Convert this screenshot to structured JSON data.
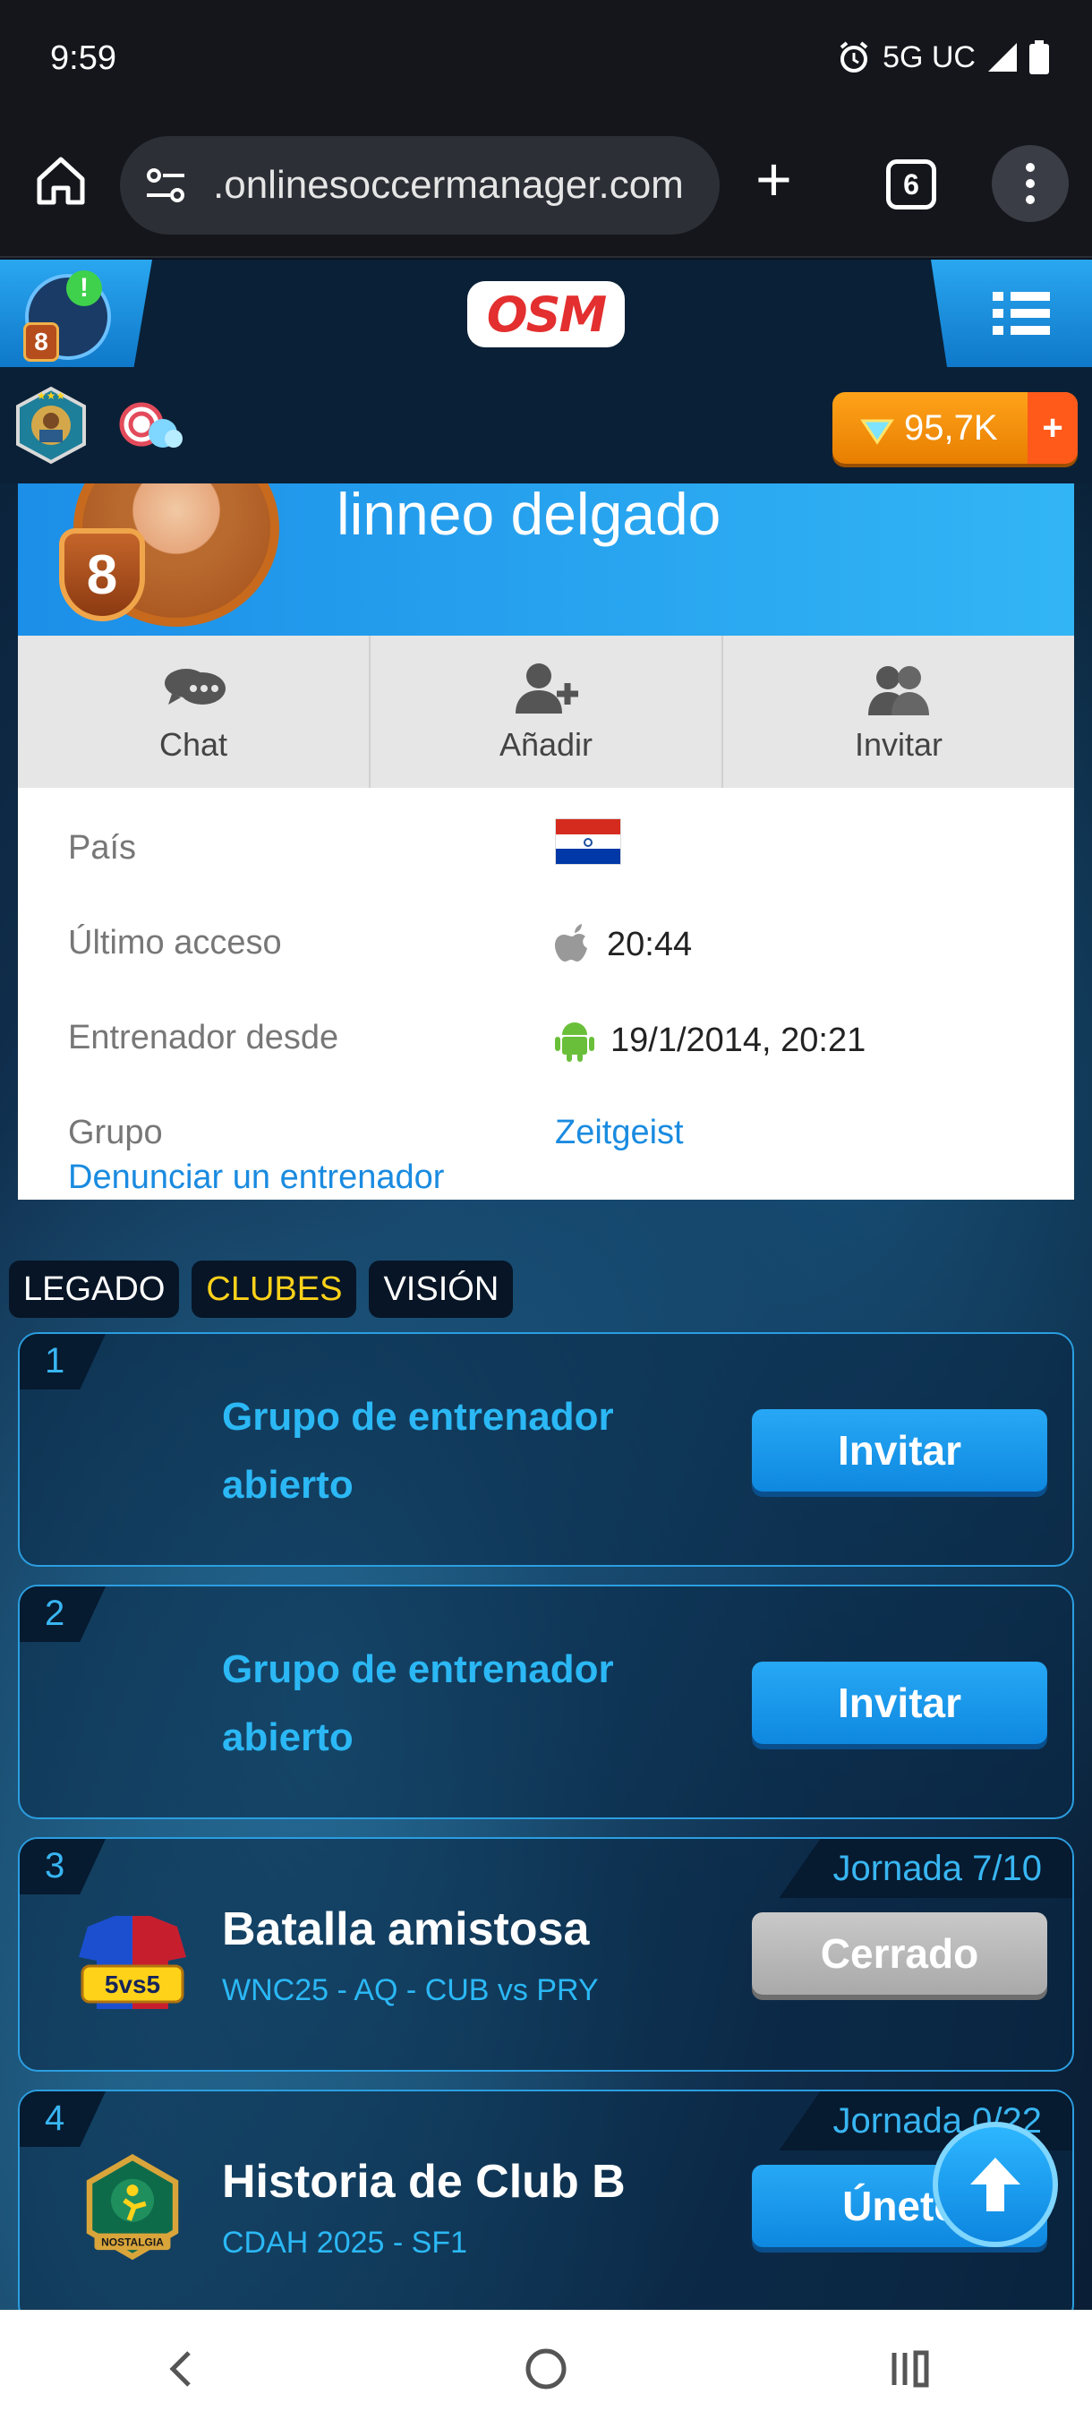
{
  "status_bar": {
    "time": "9:59",
    "network": "5G UC"
  },
  "browser": {
    "url": ".onlinesoccermanager.com",
    "tab_count": "6"
  },
  "osm_header": {
    "logo_text": "OSM",
    "level": "8",
    "notification_mark": "!",
    "coins": "95,7K",
    "coins_plus": "+"
  },
  "profile": {
    "name": "linneo delgado",
    "level": "8",
    "actions": {
      "chat": "Chat",
      "add": "Añadir",
      "invite": "Invitar"
    },
    "country_label": "País",
    "last_access_label": "Último acceso",
    "last_access_value": "20:44",
    "coach_since_label": "Entrenador desde",
    "coach_since_value": "19/1/2014, 20:21",
    "group_label": "Grupo",
    "group_value": "Zeitgeist",
    "report_link": "Denunciar un entrenador",
    "flag_colors": [
      "#d52b1e",
      "#ffffff",
      "#0038a8"
    ]
  },
  "tabs": [
    {
      "label": "LEGADO",
      "active": false
    },
    {
      "label": "CLUBES",
      "active": true
    },
    {
      "label": "VISIÓN",
      "active": false
    }
  ],
  "cards": [
    {
      "index": "1",
      "title_line1": "Grupo de entrenador",
      "title_line2": "abierto",
      "button": "Invitar"
    },
    {
      "index": "2",
      "title_line1": "Grupo de entrenador",
      "title_line2": "abierto",
      "button": "Invitar"
    },
    {
      "index": "3",
      "title": "Batalla amistosa",
      "subtitle": "WNC25 - AQ - CUB vs PRY",
      "round": "Jornada 7/10",
      "button": "Cerrado",
      "icon_text": "5vs5"
    },
    {
      "index": "4",
      "title": "Historia de Club B",
      "subtitle": "CDAH 2025 - SF1",
      "round": "Jornada 0/22",
      "button": "Únete",
      "icon_text": "NOSTALGIA"
    }
  ],
  "colors": {
    "accent_blue": "#1a8be0",
    "header_dark": "#0a2036",
    "coins_orange": "#ffa31a",
    "tab_active": "#ffd21a"
  }
}
